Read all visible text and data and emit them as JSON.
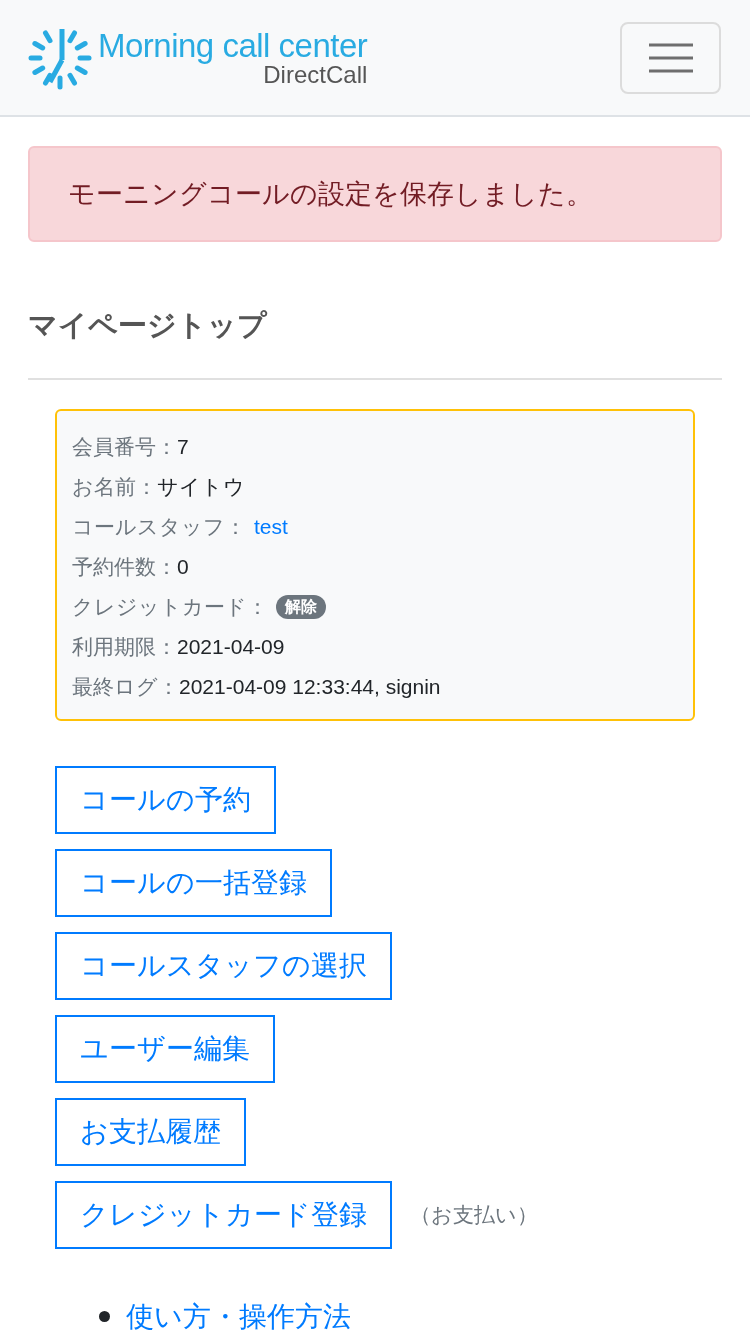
{
  "header": {
    "logo_title": "Morning call center",
    "logo_subtitle": "DirectCall"
  },
  "alert": {
    "message": "モーニングコールの設定を保存しました。"
  },
  "page_title": "マイページトップ",
  "member_info": [
    {
      "label": "会員番号：",
      "value": "7",
      "kind": "text"
    },
    {
      "label": "お名前：",
      "value": "サイトウ",
      "kind": "text"
    },
    {
      "label": "コールスタッフ：",
      "value": "test",
      "kind": "link"
    },
    {
      "label": "予約件数：",
      "value": "0",
      "kind": "text"
    },
    {
      "label": "クレジットカード：",
      "value": "解除",
      "kind": "badge"
    },
    {
      "label": "利用期限：",
      "value": "2021-04-09",
      "kind": "text"
    },
    {
      "label": "最終ログ：",
      "value": "2021-04-09 12:33:44, signin",
      "kind": "text"
    }
  ],
  "actions": [
    {
      "label": "コールの予約"
    },
    {
      "label": "コールの一括登録"
    },
    {
      "label": "コールスタッフの選択"
    },
    {
      "label": "ユーザー編集"
    },
    {
      "label": "お支払履歴"
    },
    {
      "label": "クレジットカード登録",
      "note": "（お支払い）"
    }
  ],
  "links": [
    "使い方・操作方法"
  ]
}
